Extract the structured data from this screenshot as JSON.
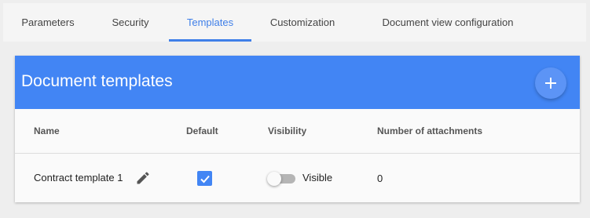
{
  "tabs": [
    {
      "label": "Parameters",
      "active": false
    },
    {
      "label": "Security",
      "active": false
    },
    {
      "label": "Templates",
      "active": true
    },
    {
      "label": "Customization",
      "active": false
    },
    {
      "label": "Document view configuration",
      "active": false
    }
  ],
  "panel": {
    "title": "Document templates",
    "add_icon": "plus-icon"
  },
  "table": {
    "columns": [
      "Name",
      "Default",
      "Visibility",
      "Number of attachments"
    ],
    "rows": [
      {
        "name": "Contract template 1",
        "edit_icon": "pencil-icon",
        "default": true,
        "visibility_on": false,
        "visibility_label": "Visible",
        "attachments": "0"
      }
    ]
  },
  "colors": {
    "accent": "#4285f4",
    "active_tab": "#3f7fe8",
    "background": "#eeeeee"
  }
}
